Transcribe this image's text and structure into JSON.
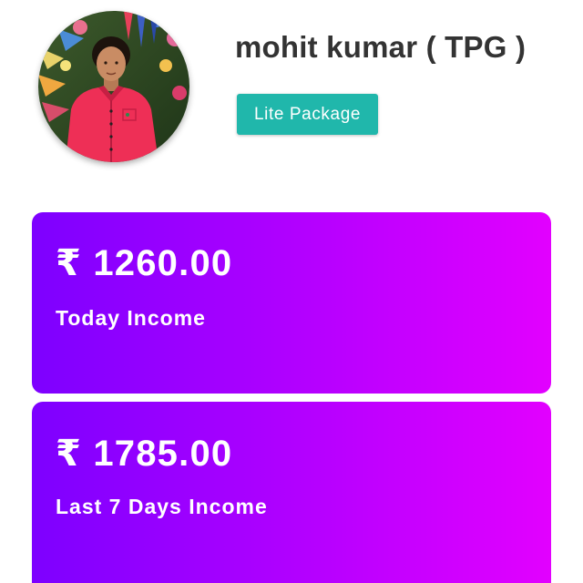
{
  "profile": {
    "name": "mohit kumar ( TPG )",
    "package_label": "Lite Package",
    "avatar_icon": "profile-photo"
  },
  "income_cards": [
    {
      "amount": "₹ 1260.00",
      "label": "Today Income"
    },
    {
      "amount": "₹ 1785.00",
      "label": "Last 7 Days Income"
    }
  ],
  "colors": {
    "badge": "#20b7ab",
    "card_gradient_start": "#7d00ff",
    "card_gradient_end": "#e200ff",
    "name_text": "#333333"
  }
}
